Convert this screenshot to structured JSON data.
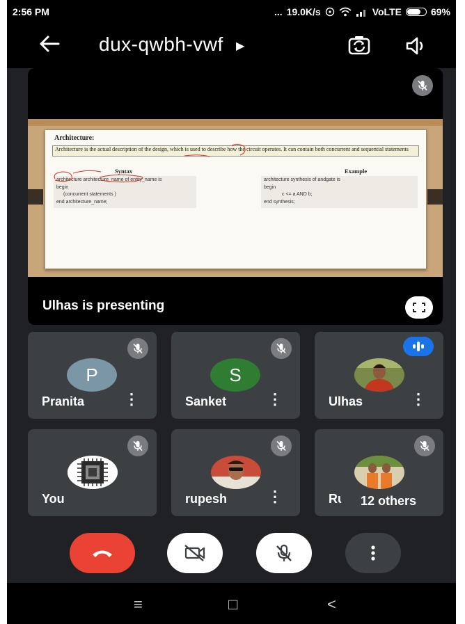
{
  "status_bar": {
    "time": "2:56 PM",
    "dots": "...",
    "speed": "19.0K/s",
    "network": "VoLTE",
    "battery": "69%"
  },
  "header": {
    "meeting_code": "dux-qwbh-vwf",
    "icons": [
      "back-arrow-icon",
      "caret-right-icon",
      "switch-camera-icon",
      "speaker-icon"
    ]
  },
  "presentation": {
    "label": "Ulhas is presenting",
    "slide": {
      "title": "Architecture:",
      "definition": "Architecture is the actual description of the design, which is used to describe how the circuit operates. It can contain both concurrent and sequential statements",
      "syntax_heading": "Syntax",
      "example_heading": "Example",
      "syntax_lines": [
        "architecture architecture_name of entity_name is",
        "begin",
        "(concurrent statements )",
        "end architecture_name;"
      ],
      "example_lines": [
        "architecture synthesis of andgate is",
        "begin",
        "c <= a AND b;",
        "end synthesis;"
      ]
    }
  },
  "participants": [
    {
      "name": "Pranita",
      "initial": "P",
      "avatar_color": "#7b97a6",
      "muted": true
    },
    {
      "name": "Sanket",
      "initial": "S",
      "avatar_color": "#2e7d32",
      "muted": true
    },
    {
      "name": "Ulhas",
      "speaking": true
    },
    {
      "name": "You",
      "muted": true
    },
    {
      "name": "rupesh",
      "muted": true
    },
    {
      "name": "Ru",
      "muted": true,
      "overlay": "12 others"
    }
  ],
  "controls": {
    "items": [
      "end-call-icon",
      "camera-off-icon",
      "mic-off-icon",
      "more-options-icon"
    ],
    "end_call_color": "#ea4335"
  },
  "nav": {
    "menu": "≡",
    "home": "□",
    "back": "<"
  }
}
